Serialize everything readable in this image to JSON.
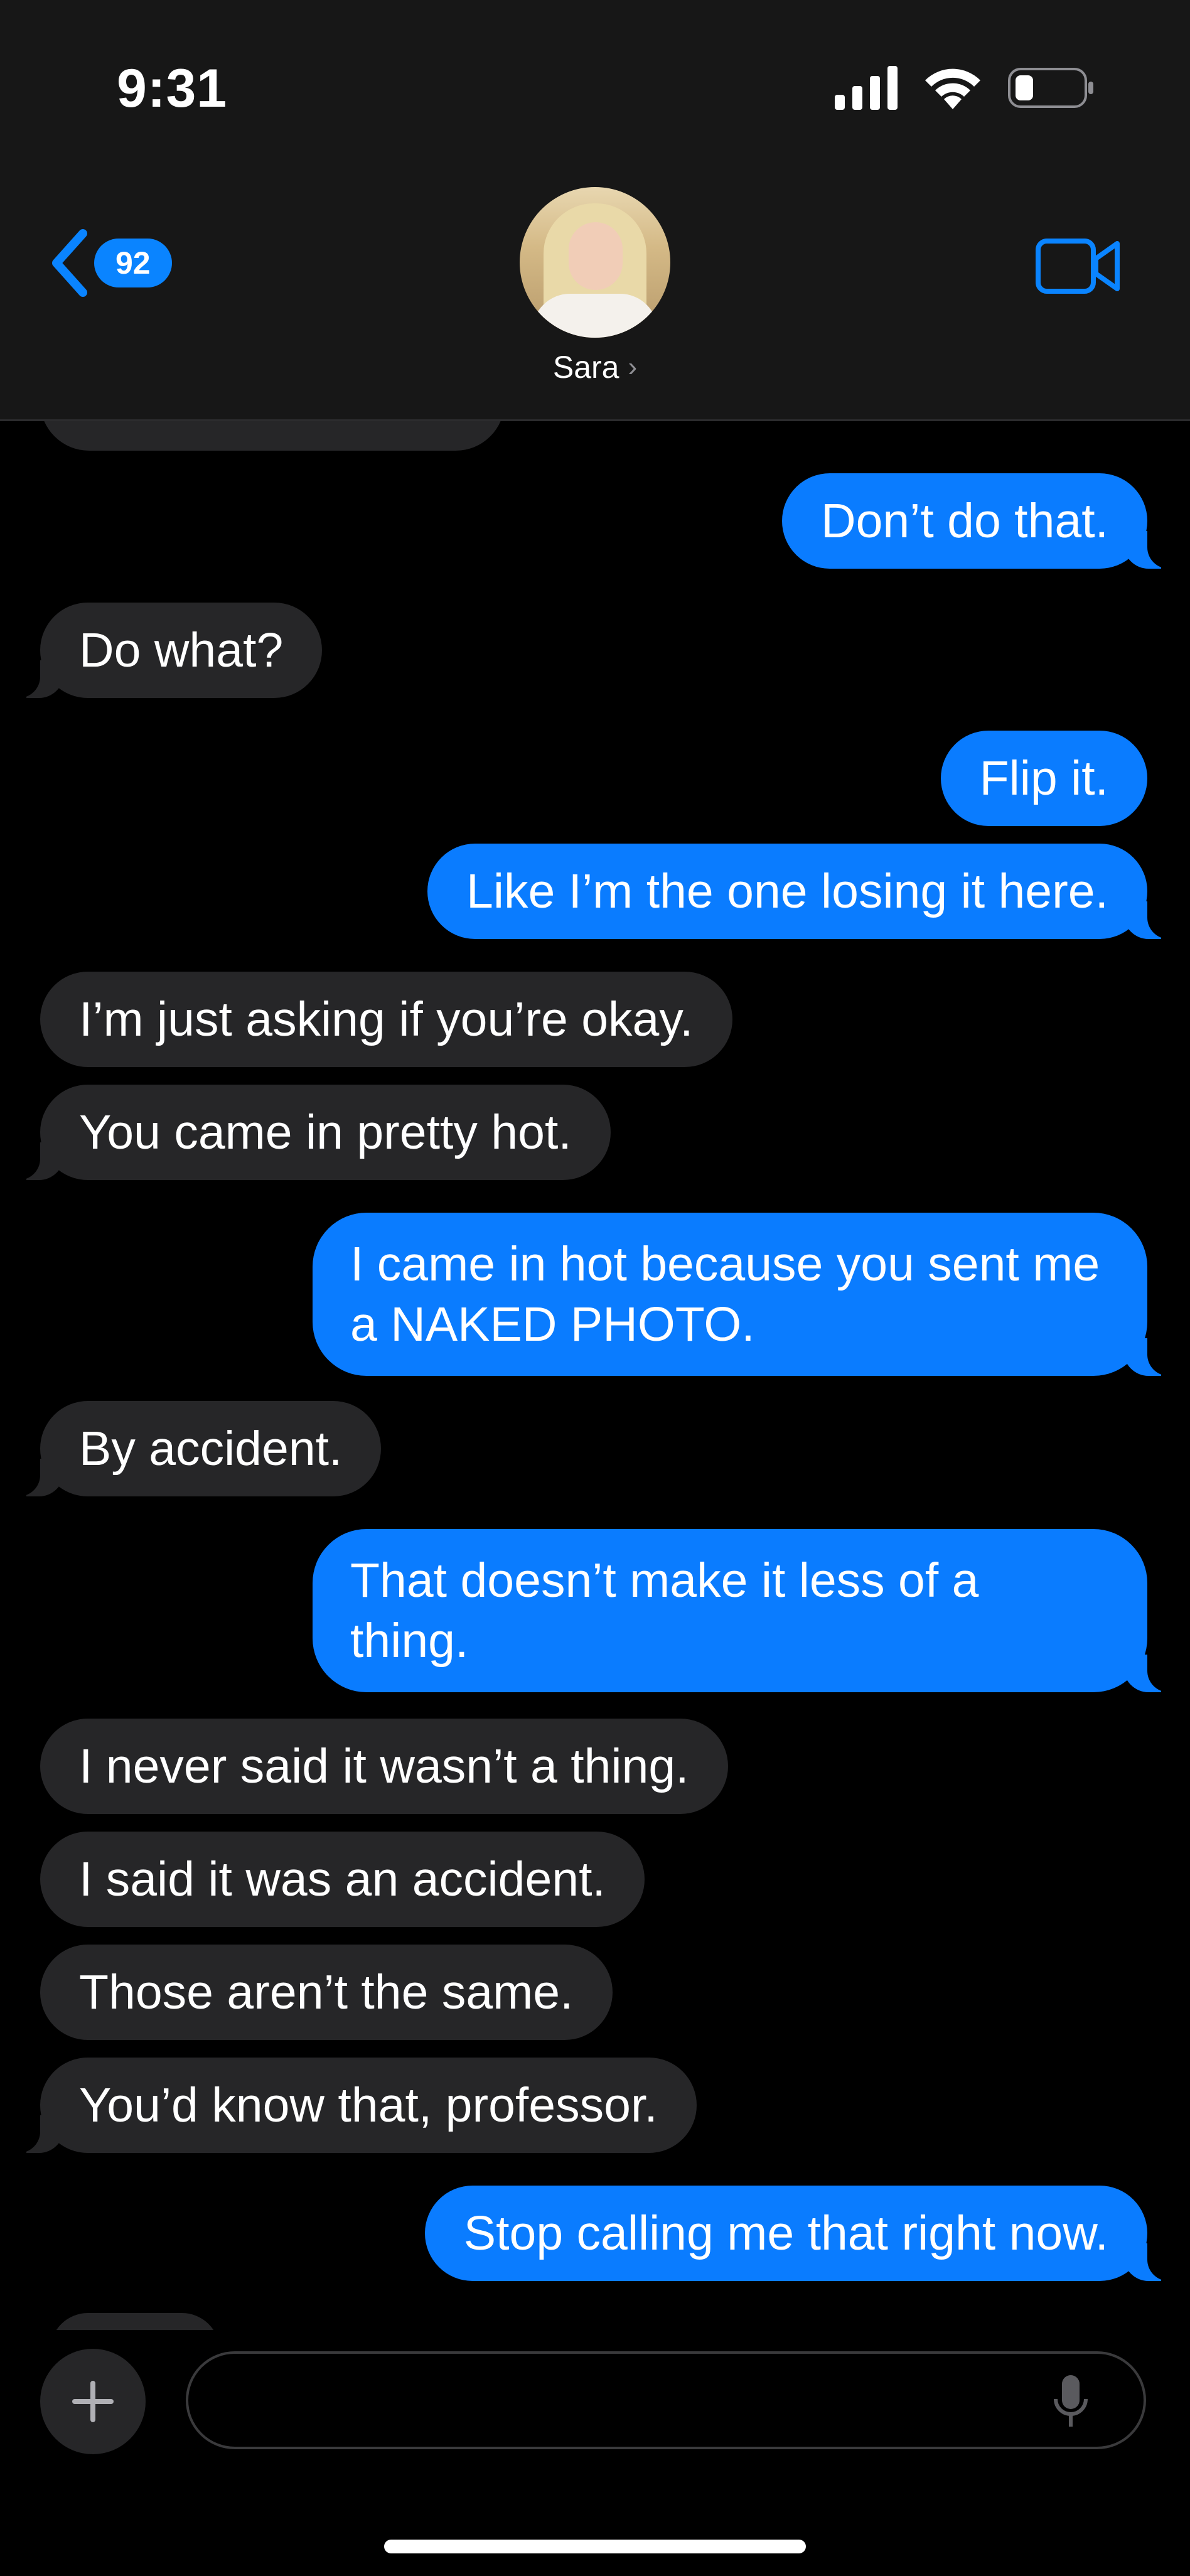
{
  "status_bar": {
    "time": "9:31"
  },
  "header": {
    "back_badge": "92",
    "contact_name": "Sara"
  },
  "messages": [
    {
      "side": "out",
      "text": "Don’t do that."
    },
    {
      "side": "in",
      "text": "Do what?"
    },
    {
      "side": "out",
      "text": "Flip it."
    },
    {
      "side": "out",
      "text": "Like I’m the one losing it here."
    },
    {
      "side": "in",
      "text": "I’m just asking if you’re okay."
    },
    {
      "side": "in",
      "text": "You came in pretty hot."
    },
    {
      "side": "out",
      "text": "I came in hot because you sent me a NAKED PHOTO."
    },
    {
      "side": "in",
      "text": "By accident."
    },
    {
      "side": "out",
      "text": "That doesn’t make it less of a thing."
    },
    {
      "side": "in",
      "text": "I never said it wasn’t a thing."
    },
    {
      "side": "in",
      "text": "I said it was an accident."
    },
    {
      "side": "in",
      "text": "Those aren’t the same."
    },
    {
      "side": "in",
      "text": "You’d know that, professor."
    },
    {
      "side": "out",
      "text": "Stop calling me that right now."
    }
  ],
  "composer": {
    "placeholder": ""
  },
  "colors": {
    "outgoing": "#0a7cff",
    "incoming": "#262628",
    "accent": "#0a84ff"
  }
}
